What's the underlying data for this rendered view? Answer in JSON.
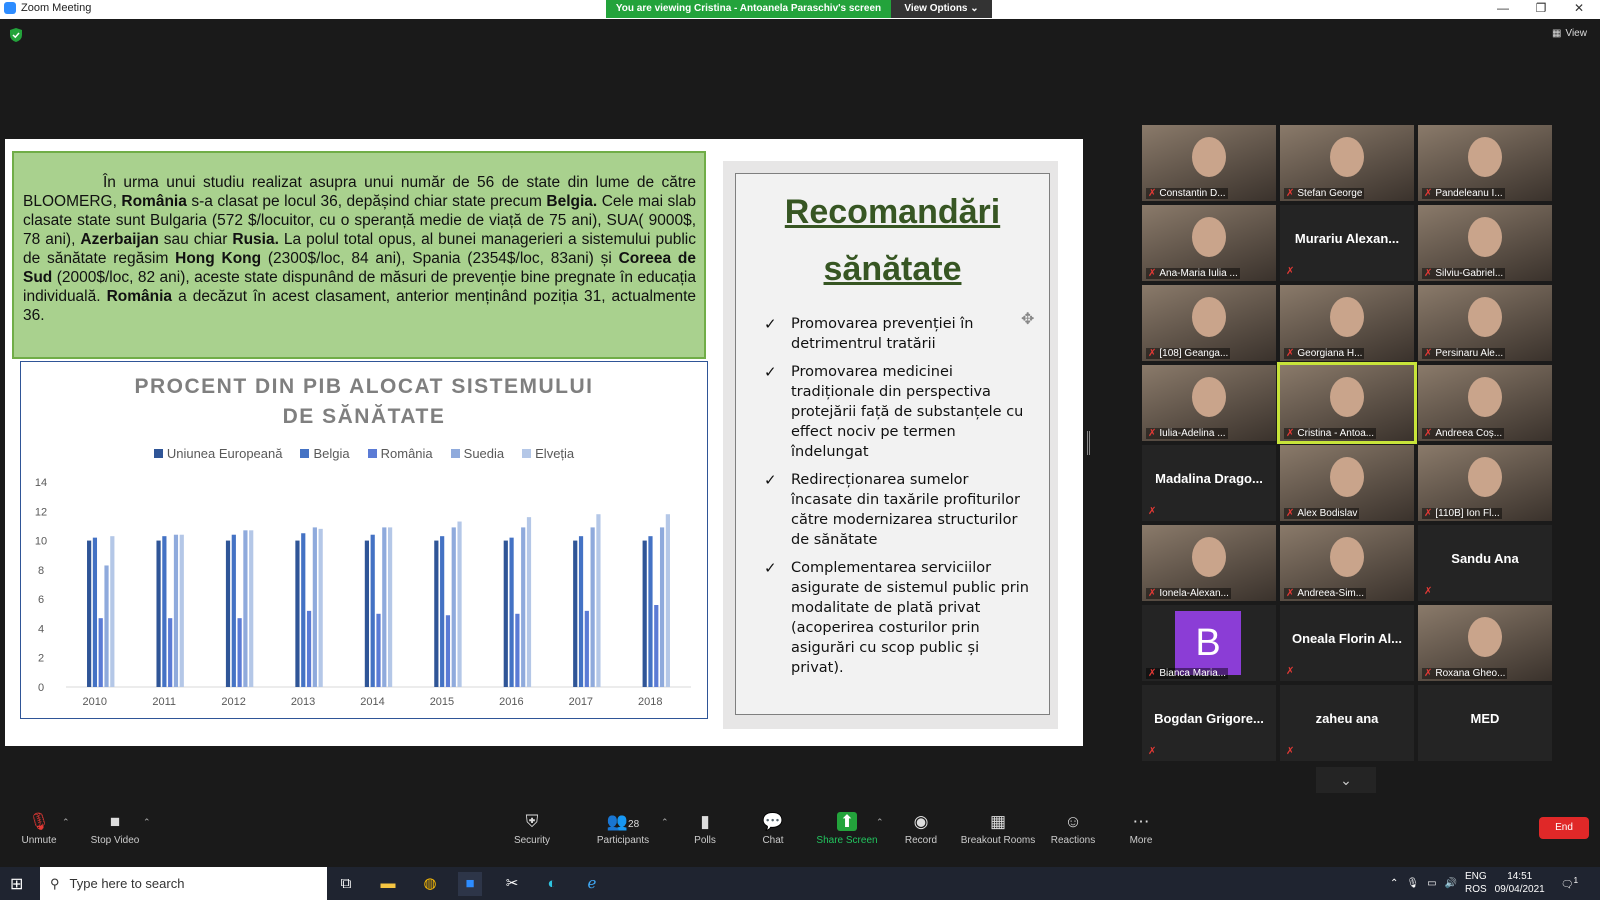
{
  "window": {
    "title": "Zoom Meeting",
    "viewing_banner": "You are viewing Cristina - Antoanela Paraschiv's screen",
    "view_options": "View Options ⌄",
    "view_button": "View"
  },
  "slide": {
    "paragraph": [
      {
        "t": "În urma unui studiu realizat asupra unui număr de 56 de state din lume de către BLOOMERG, ",
        "b": false
      },
      {
        "t": "România",
        "b": true
      },
      {
        "t": " s-a clasat pe locul 36, depășind chiar state precum ",
        "b": false
      },
      {
        "t": "Belgia.",
        "b": true
      },
      {
        "t": " Cele mai slab clasate state sunt Bulgaria (572 $/locuitor, cu o speranță medie de viață de 75 ani), SUA( 9000$, 78 ani), ",
        "b": false
      },
      {
        "t": "Azerbaijan",
        "b": true
      },
      {
        "t": " sau chiar ",
        "b": false
      },
      {
        "t": "Rusia.",
        "b": true
      },
      {
        "t": " La polul total opus, al bunei managerieri a sistemului public de sănătate regăsim ",
        "b": false
      },
      {
        "t": "Hong Kong",
        "b": true
      },
      {
        "t": " (2300$/loc, 84 ani), Spania (2354$/loc, 83ani) și ",
        "b": false
      },
      {
        "t": "Coreea de Sud",
        "b": true
      },
      {
        "t": " (2000$/loc, 82 ani), aceste state dispunând de măsuri de prevenție bine pregnate în educația individuală. ",
        "b": false
      },
      {
        "t": "România",
        "b": true
      },
      {
        "t": " a decăzut în acest clasament, anterior menținând poziția 31, actualmente 36.",
        "b": false
      }
    ],
    "recommendations": {
      "title_line1": "Recomandări",
      "title_line2": "sănătate",
      "check_symbol": "✓",
      "items": [
        "Promovarea prevenției în detrimentrul tratării",
        "Promovarea medicinei tradiționale din perspectiva protejării față de substanțele cu effect nociv pe termen îndelungat",
        "Redirecționarea sumelor încasate din taxările profiturilor către modernizarea structurilor de sănătate",
        "Complementarea serviciilor asigurate de sistemul public prin modalitate de plată privat (acoperirea costurilor prin asigurări cu scop public și privat)."
      ]
    }
  },
  "chart_data": {
    "type": "bar",
    "title_line1": "PROCENT DIN PIB ALOCAT SISTEMULUI",
    "title_line2": "DE SĂNĂTATE",
    "categories": [
      "2010",
      "2011",
      "2012",
      "2013",
      "2014",
      "2015",
      "2016",
      "2017",
      "2018"
    ],
    "ylim": [
      0,
      14
    ],
    "yticks": [
      "0",
      "2",
      "4",
      "6",
      "8",
      "10",
      "12",
      "14"
    ],
    "grid": false,
    "legend_position": "top",
    "series": [
      {
        "name": "Uniunea Europeană",
        "color": "#2f5597",
        "values": [
          10.0,
          10.0,
          10.0,
          10.0,
          10.0,
          10.0,
          10.0,
          10.0,
          10.0
        ]
      },
      {
        "name": "Belgia",
        "color": "#4472c4",
        "values": [
          10.2,
          10.3,
          10.4,
          10.5,
          10.4,
          10.3,
          10.2,
          10.3,
          10.3
        ]
      },
      {
        "name": "România",
        "color": "#5b7bd5",
        "values": [
          4.7,
          4.7,
          4.7,
          5.2,
          5.0,
          4.9,
          5.0,
          5.2,
          5.6
        ]
      },
      {
        "name": "Suedia",
        "color": "#8faadc",
        "values": [
          8.3,
          10.4,
          10.7,
          10.9,
          10.9,
          10.9,
          10.9,
          10.9,
          10.9
        ]
      },
      {
        "name": "Elveția",
        "color": "#b4c7e7",
        "values": [
          10.3,
          10.4,
          10.7,
          10.8,
          10.9,
          11.3,
          11.6,
          11.8,
          11.8
        ]
      }
    ]
  },
  "participants": [
    {
      "name": "Constantin D...",
      "kind": "video"
    },
    {
      "name": "Stefan George",
      "kind": "video"
    },
    {
      "name": "Pandeleanu I...",
      "kind": "video"
    },
    {
      "name": "Ana-Maria Iulia ...",
      "kind": "video"
    },
    {
      "name": "Murariu Alexan...",
      "kind": "name"
    },
    {
      "name": "Silviu-Gabriel...",
      "kind": "video"
    },
    {
      "name": "[108] Geanga...",
      "kind": "video"
    },
    {
      "name": "Georgiana H...",
      "kind": "video"
    },
    {
      "name": "Persinaru Ale...",
      "kind": "video"
    },
    {
      "name": "Iulia-Adelina ...",
      "kind": "video"
    },
    {
      "name": "Cristina - Antoa...",
      "kind": "video",
      "active": true
    },
    {
      "name": "Andreea Coș...",
      "kind": "video"
    },
    {
      "name": "Madalina Drago...",
      "kind": "name"
    },
    {
      "name": "Alex Bodislav",
      "kind": "video"
    },
    {
      "name": "[110B] Ion Fl...",
      "kind": "video"
    },
    {
      "name": "Ionela-Alexan...",
      "kind": "video"
    },
    {
      "name": "Andreea-Sim...",
      "kind": "video"
    },
    {
      "name": "Sandu Ana",
      "kind": "name"
    },
    {
      "name": "Bianca Maria...",
      "kind": "avatar",
      "letter": "B"
    },
    {
      "name": "Oneala Florin Al...",
      "kind": "name"
    },
    {
      "name": "Roxana Gheo...",
      "kind": "video"
    },
    {
      "name": "Bogdan Grigore...",
      "kind": "name"
    },
    {
      "name": "zaheu ana",
      "kind": "name"
    },
    {
      "name": "MED",
      "kind": "name",
      "nomute": true
    }
  ],
  "toolbar": {
    "unmute": "Unmute",
    "stop_video": "Stop Video",
    "security": "Security",
    "participants": "Participants",
    "participants_count": "28",
    "polls": "Polls",
    "chat": "Chat",
    "share_screen": "Share Screen",
    "record": "Record",
    "breakout_rooms": "Breakout Rooms",
    "reactions": "Reactions",
    "more": "More",
    "end": "End"
  },
  "taskbar": {
    "search_placeholder": "Type here to search",
    "lang_line1": "ENG",
    "lang_line2": "ROS",
    "time": "14:51",
    "date": "09/04/2021",
    "notifications": "1"
  }
}
